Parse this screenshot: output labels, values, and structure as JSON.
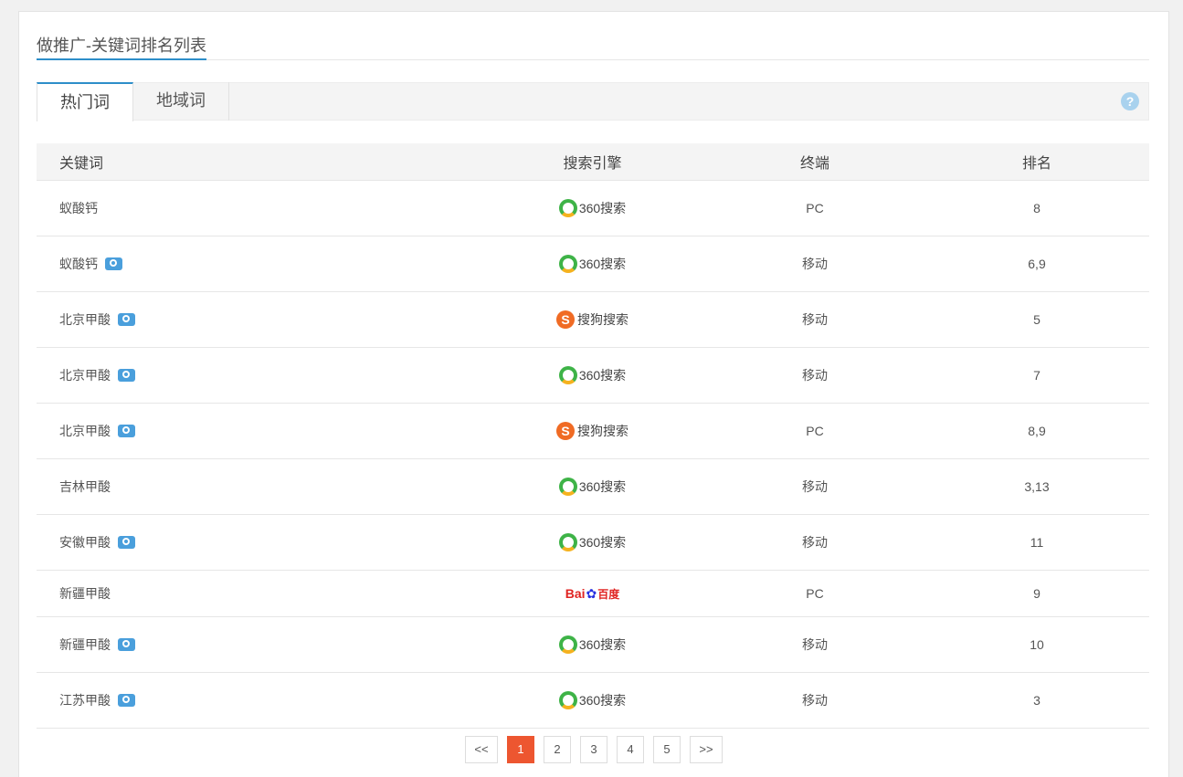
{
  "page": {
    "title": "做推广-关键词排名列表"
  },
  "tabs": [
    {
      "label": "热门词",
      "active": true
    },
    {
      "label": "地域词",
      "active": false
    }
  ],
  "help_icon": "question-circle-icon",
  "table": {
    "headers": {
      "keyword": "关键词",
      "engine": "搜索引擎",
      "terminal": "终端",
      "rank": "排名"
    },
    "rows": [
      {
        "keyword": "蚁酸钙",
        "camera": false,
        "engine": "360搜索",
        "engine_logo": "360",
        "terminal": "PC",
        "rank": "8"
      },
      {
        "keyword": "蚁酸钙",
        "camera": true,
        "engine": "360搜索",
        "engine_logo": "360",
        "terminal": "移动",
        "rank": "6,9"
      },
      {
        "keyword": "北京甲酸",
        "camera": true,
        "engine": "搜狗搜索",
        "engine_logo": "sogou",
        "terminal": "移动",
        "rank": "5"
      },
      {
        "keyword": "北京甲酸",
        "camera": true,
        "engine": "360搜索",
        "engine_logo": "360",
        "terminal": "移动",
        "rank": "7"
      },
      {
        "keyword": "北京甲酸",
        "camera": true,
        "engine": "搜狗搜索",
        "engine_logo": "sogou",
        "terminal": "PC",
        "rank": "8,9"
      },
      {
        "keyword": "吉林甲酸",
        "camera": false,
        "engine": "360搜索",
        "engine_logo": "360",
        "terminal": "移动",
        "rank": "3,13"
      },
      {
        "keyword": "安徽甲酸",
        "camera": true,
        "engine": "360搜索",
        "engine_logo": "360",
        "terminal": "移动",
        "rank": "11"
      },
      {
        "keyword": "新疆甲酸",
        "camera": false,
        "engine": "Bai百度",
        "engine_logo": "baidu",
        "terminal": "PC",
        "rank": "9"
      },
      {
        "keyword": "新疆甲酸",
        "camera": true,
        "engine": "360搜索",
        "engine_logo": "360",
        "terminal": "移动",
        "rank": "10"
      },
      {
        "keyword": "江苏甲酸",
        "camera": true,
        "engine": "360搜索",
        "engine_logo": "360",
        "terminal": "移动",
        "rank": "3"
      }
    ]
  },
  "pagination": {
    "prev": "<<",
    "pages": [
      "1",
      "2",
      "3",
      "4",
      "5"
    ],
    "current": "1",
    "next": ">>"
  },
  "colors": {
    "accent": "#2d8ec9",
    "pager_active": "#ed5630",
    "camera_icon": "#4a9fdc"
  }
}
